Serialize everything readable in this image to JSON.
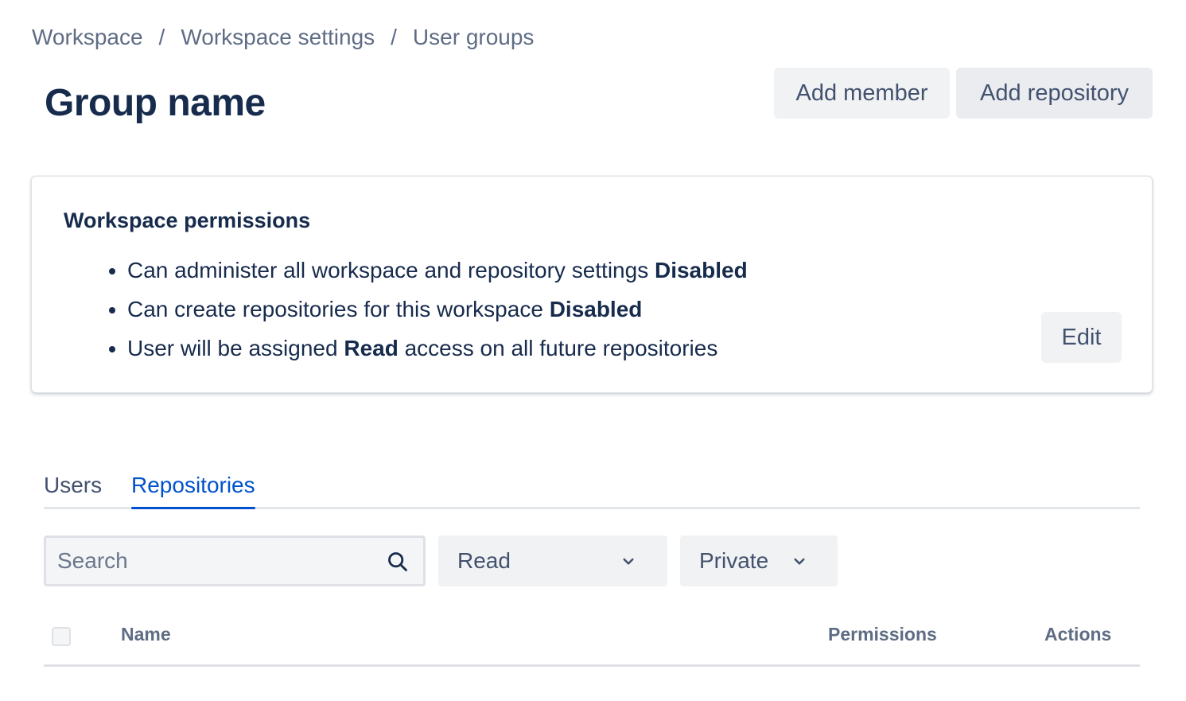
{
  "breadcrumb": {
    "items": [
      "Workspace",
      "Workspace settings",
      "User groups"
    ],
    "separator": "/"
  },
  "page": {
    "title": "Group name"
  },
  "header_actions": {
    "add_member_label": "Add member",
    "add_repository_label": "Add repository"
  },
  "permissions": {
    "title": "Workspace permissions",
    "items": [
      {
        "text": "Can administer all workspace and repository settings ",
        "value": "Disabled"
      },
      {
        "text": "Can create repositories for this workspace ",
        "value": "Disabled"
      },
      {
        "prefix": "User will be assigned ",
        "value": "Read",
        "suffix": " access on all future repositories"
      }
    ],
    "edit_label": "Edit"
  },
  "tabs": {
    "items": [
      "Users",
      "Repositories"
    ],
    "active": "Repositories"
  },
  "filters": {
    "search_placeholder": "Search",
    "search_icon": "search-icon",
    "permission_value": "Read",
    "visibility_value": "Private",
    "dropdown_icon": "chevron-down-icon"
  },
  "table": {
    "columns": [
      "Name",
      "Permissions",
      "Actions"
    ],
    "rows": []
  },
  "colors": {
    "text_primary": "#172b4d",
    "text_secondary": "#42526e",
    "text_subtle": "#5e6c84",
    "accent": "#0052cc",
    "button_bg": "#f1f2f4",
    "border": "#dfe1e6"
  }
}
